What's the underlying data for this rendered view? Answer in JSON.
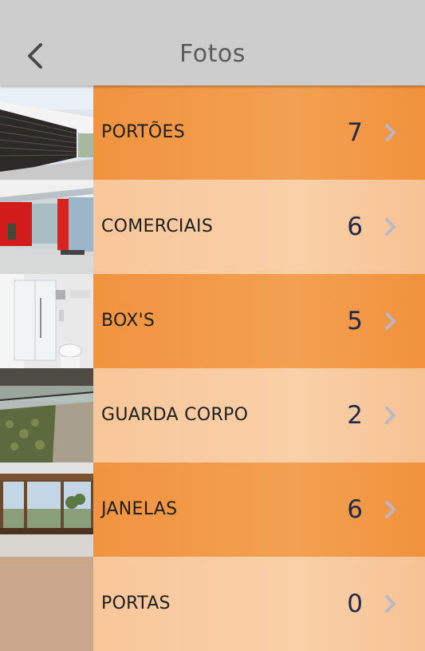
{
  "header": {
    "title": "Fotos",
    "back_icon": "chevron-left-icon"
  },
  "categories": [
    {
      "label": "PORTÕES",
      "count": "7",
      "thumb": "slatted-gate-photo"
    },
    {
      "label": "COMERCIAIS",
      "count": "6",
      "thumb": "storefront-photo"
    },
    {
      "label": "BOX'S",
      "count": "5",
      "thumb": "shower-box-photo"
    },
    {
      "label": "GUARDA CORPO",
      "count": "2",
      "thumb": "glass-railing-photo"
    },
    {
      "label": "JANELAS",
      "count": "6",
      "thumb": "window-view-photo"
    },
    {
      "label": "PORTAS",
      "count": "0",
      "thumb": "door-placeholder"
    }
  ],
  "colors": {
    "header_bg": "#cdcdcd",
    "row_dark": "#ef8e38",
    "row_light": "#f8c394",
    "count_text": "#1f2a4a",
    "chevron": "#b8b8c8"
  }
}
